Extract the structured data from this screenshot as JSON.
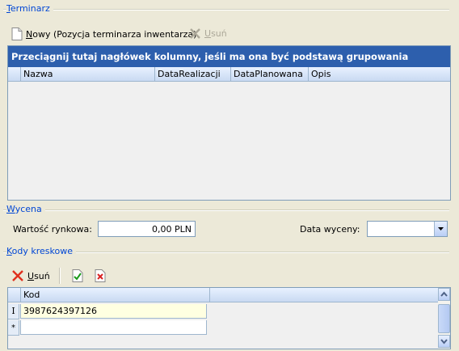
{
  "terminarz": {
    "title": "Terminarz",
    "title_accel": "T",
    "title_rest": "erminarz",
    "toolbar": {
      "new_accel": "N",
      "new_rest": "owy (Pozycja terminarza inwentarza)",
      "delete_accel": "U",
      "delete_rest": "suń"
    },
    "group_hint": "Przeciągnij tutaj nagłówek kolumny, jeśli ma ona być podstawą grupowania",
    "columns": [
      "Nazwa",
      "DataRealizacji",
      "DataPlanowana",
      "Opis"
    ]
  },
  "wycena": {
    "title_accel": "W",
    "title_rest": "ycena",
    "market_value_label": "Wartość rynkowa:",
    "market_value": "0,00 PLN",
    "valuation_date_label": "Data wyceny:",
    "valuation_date": ""
  },
  "kody": {
    "title_accel": "K",
    "title_rest": "ody kreskowe",
    "toolbar": {
      "delete_accel": "U",
      "delete_rest": "suń"
    },
    "column": "Kod",
    "rows": [
      {
        "indicator": "I",
        "value": "3987624397126"
      },
      {
        "indicator": "*",
        "value": ""
      }
    ]
  },
  "colors": {
    "accent": "#0046d5",
    "group_bar": "#2d5fad",
    "highlight_row": "#ffffe1"
  }
}
